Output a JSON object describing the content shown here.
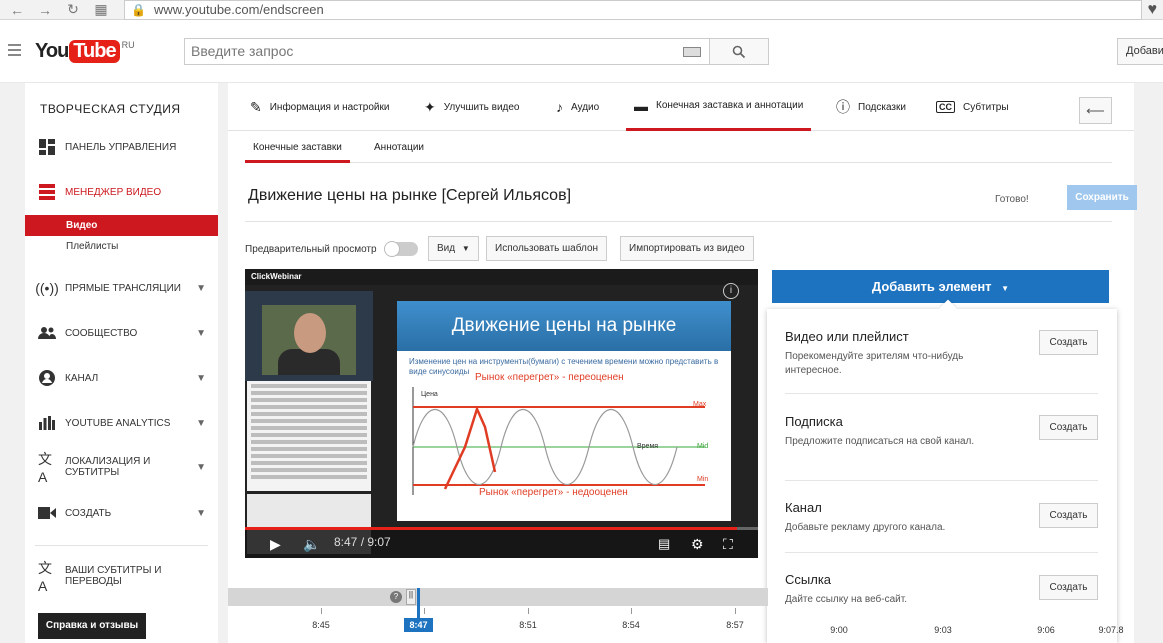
{
  "browser": {
    "url": "www.youtube.com/endscreen"
  },
  "header": {
    "logo_you": "You",
    "logo_tube": "Tube",
    "logo_region": "RU",
    "search_placeholder": "Введите запрос",
    "add_button": "Добави"
  },
  "sidebar": {
    "title": "ТВОРЧЕСКАЯ СТУДИЯ",
    "items": [
      {
        "label": "ПАНЕЛЬ УПРАВЛЕНИЯ",
        "icon": "dashboard-icon"
      },
      {
        "label": "МЕНЕДЖЕР ВИДЕО",
        "icon": "video-manager-icon"
      },
      {
        "label": "ПРЯМЫЕ ТРАНСЛЯЦИИ",
        "icon": "live-icon"
      },
      {
        "label": "СООБЩЕСТВО",
        "icon": "community-icon"
      },
      {
        "label": "КАНАЛ",
        "icon": "channel-icon"
      },
      {
        "label": "YOUTUBE ANALYTICS",
        "icon": "analytics-icon"
      },
      {
        "label": "ЛОКАЛИЗАЦИЯ И СУБТИТРЫ",
        "icon": "translate-icon"
      },
      {
        "label": "СОЗДАТЬ",
        "icon": "create-icon"
      },
      {
        "label": "ВАШИ СУБТИТРЫ И ПЕРЕВОДЫ",
        "icon": "subtitles-translate-icon"
      }
    ],
    "sub_items": [
      "Видео",
      "Плейлисты"
    ],
    "feedback": "Справка и отзывы"
  },
  "tabs": [
    "Информация и настройки",
    "Улучшить видео",
    "Аудио",
    "Конечная заставка и аннотации",
    "Подсказки",
    "Субтитры"
  ],
  "subtabs": [
    "Конечные заставки",
    "Аннотации"
  ],
  "video": {
    "title": "Движение цены на рынке [Сергей Ильясов]",
    "status": "Готово!",
    "save": "Сохранить",
    "preview_label": "Предварительный просмотр",
    "view_button": "Вид",
    "template_button": "Использовать шаблон",
    "import_button": "Импортировать из видео"
  },
  "player": {
    "brand": "ClickWebinar",
    "slide_title": "Движение цены на рынке",
    "slide_sub": "Изменение цен на инструменты(бумаги) с течением времени можно представить в виде синусоиды",
    "overbought": "Рынок «перегрет» - переоценен",
    "oversold": "Рынок «перегрет» - недооценен",
    "label_price": "Цена",
    "label_time": "Время",
    "label_max": "Max",
    "label_mid": "Mid",
    "label_min": "Min",
    "time": "8:47 / 9:07",
    "progress": 0.96
  },
  "add_element": {
    "label": "Добавить элемент",
    "items": [
      {
        "title": "Видео или плейлист",
        "desc": "Порекомендуйте зрителям что-нибудь интересное.",
        "button": "Создать"
      },
      {
        "title": "Подписка",
        "desc": "Предложите подписаться на свой канал.",
        "button": "Создать"
      },
      {
        "title": "Канал",
        "desc": "Добавьте рекламу другого канала.",
        "button": "Создать"
      },
      {
        "title": "Ссылка",
        "desc": "Дайте ссылку на веб-сайт.",
        "button": "Создать"
      }
    ]
  },
  "timeline": {
    "help": "?",
    "current": "8:47",
    "labels": [
      "8:45",
      "8:51",
      "8:54",
      "8:57",
      "9:00",
      "9:03",
      "9:06",
      "9:07.8"
    ]
  },
  "colors": {
    "brand_red": "#cc181e",
    "accent_blue": "#1e73c0",
    "save_disabled": "#a0c8ee"
  }
}
